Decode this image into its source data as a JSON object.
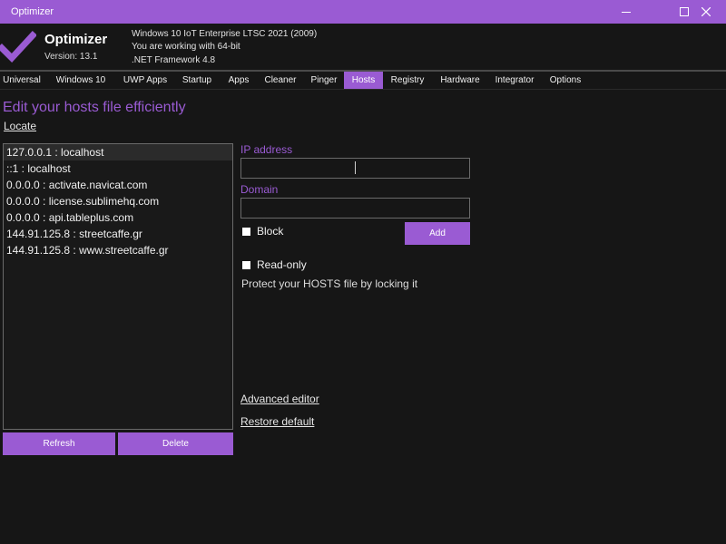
{
  "window": {
    "title": "Optimizer",
    "controls": [
      "minimize-icon",
      "maximize-icon",
      "close-icon"
    ],
    "accent_color": "#9a5bd3"
  },
  "header": {
    "app_name": "Optimizer",
    "version": "Version: 13.1",
    "os_info": "Windows 10 IoT Enterprise LTSC 2021 (2009)",
    "arch_info": "You are working with 64-bit",
    "framework_info": ".NET Framework 4.8",
    "logo_icon": "checkmark-icon"
  },
  "tabs": [
    {
      "label": "Universal",
      "active": false
    },
    {
      "label": "Windows 10",
      "active": false
    },
    {
      "label": "UWP Apps",
      "active": false
    },
    {
      "label": "Startup",
      "active": false
    },
    {
      "label": "Apps",
      "active": false
    },
    {
      "label": "Cleaner",
      "active": false
    },
    {
      "label": "Pinger",
      "active": false
    },
    {
      "label": "Hosts",
      "active": true
    },
    {
      "label": "Registry",
      "active": false
    },
    {
      "label": "Hardware",
      "active": false
    },
    {
      "label": "Integrator",
      "active": false
    },
    {
      "label": "Options",
      "active": false
    }
  ],
  "hosts_page": {
    "heading": "Edit your hosts file efficiently",
    "locate_link": "Locate",
    "entries": [
      "127.0.0.1 : localhost",
      "::1 : localhost",
      "0.0.0.0 : activate.navicat.com",
      "0.0.0.0 : license.sublimehq.com",
      "0.0.0.0 : api.tableplus.com",
      "144.91.125.8 : streetcaffe.gr",
      "144.91.125.8 : www.streetcaffe.gr"
    ],
    "selected_index": 0,
    "refresh_label": "Refresh",
    "delete_label": "Delete",
    "ip_label": "IP address",
    "ip_value": "",
    "domain_label": "Domain",
    "domain_value": "",
    "block_label": "Block",
    "add_label": "Add",
    "readonly_label": "Read-only",
    "readonly_info": "Protect your HOSTS file by locking it",
    "advanced_editor_link": "Advanced editor",
    "restore_default_link": "Restore default"
  }
}
